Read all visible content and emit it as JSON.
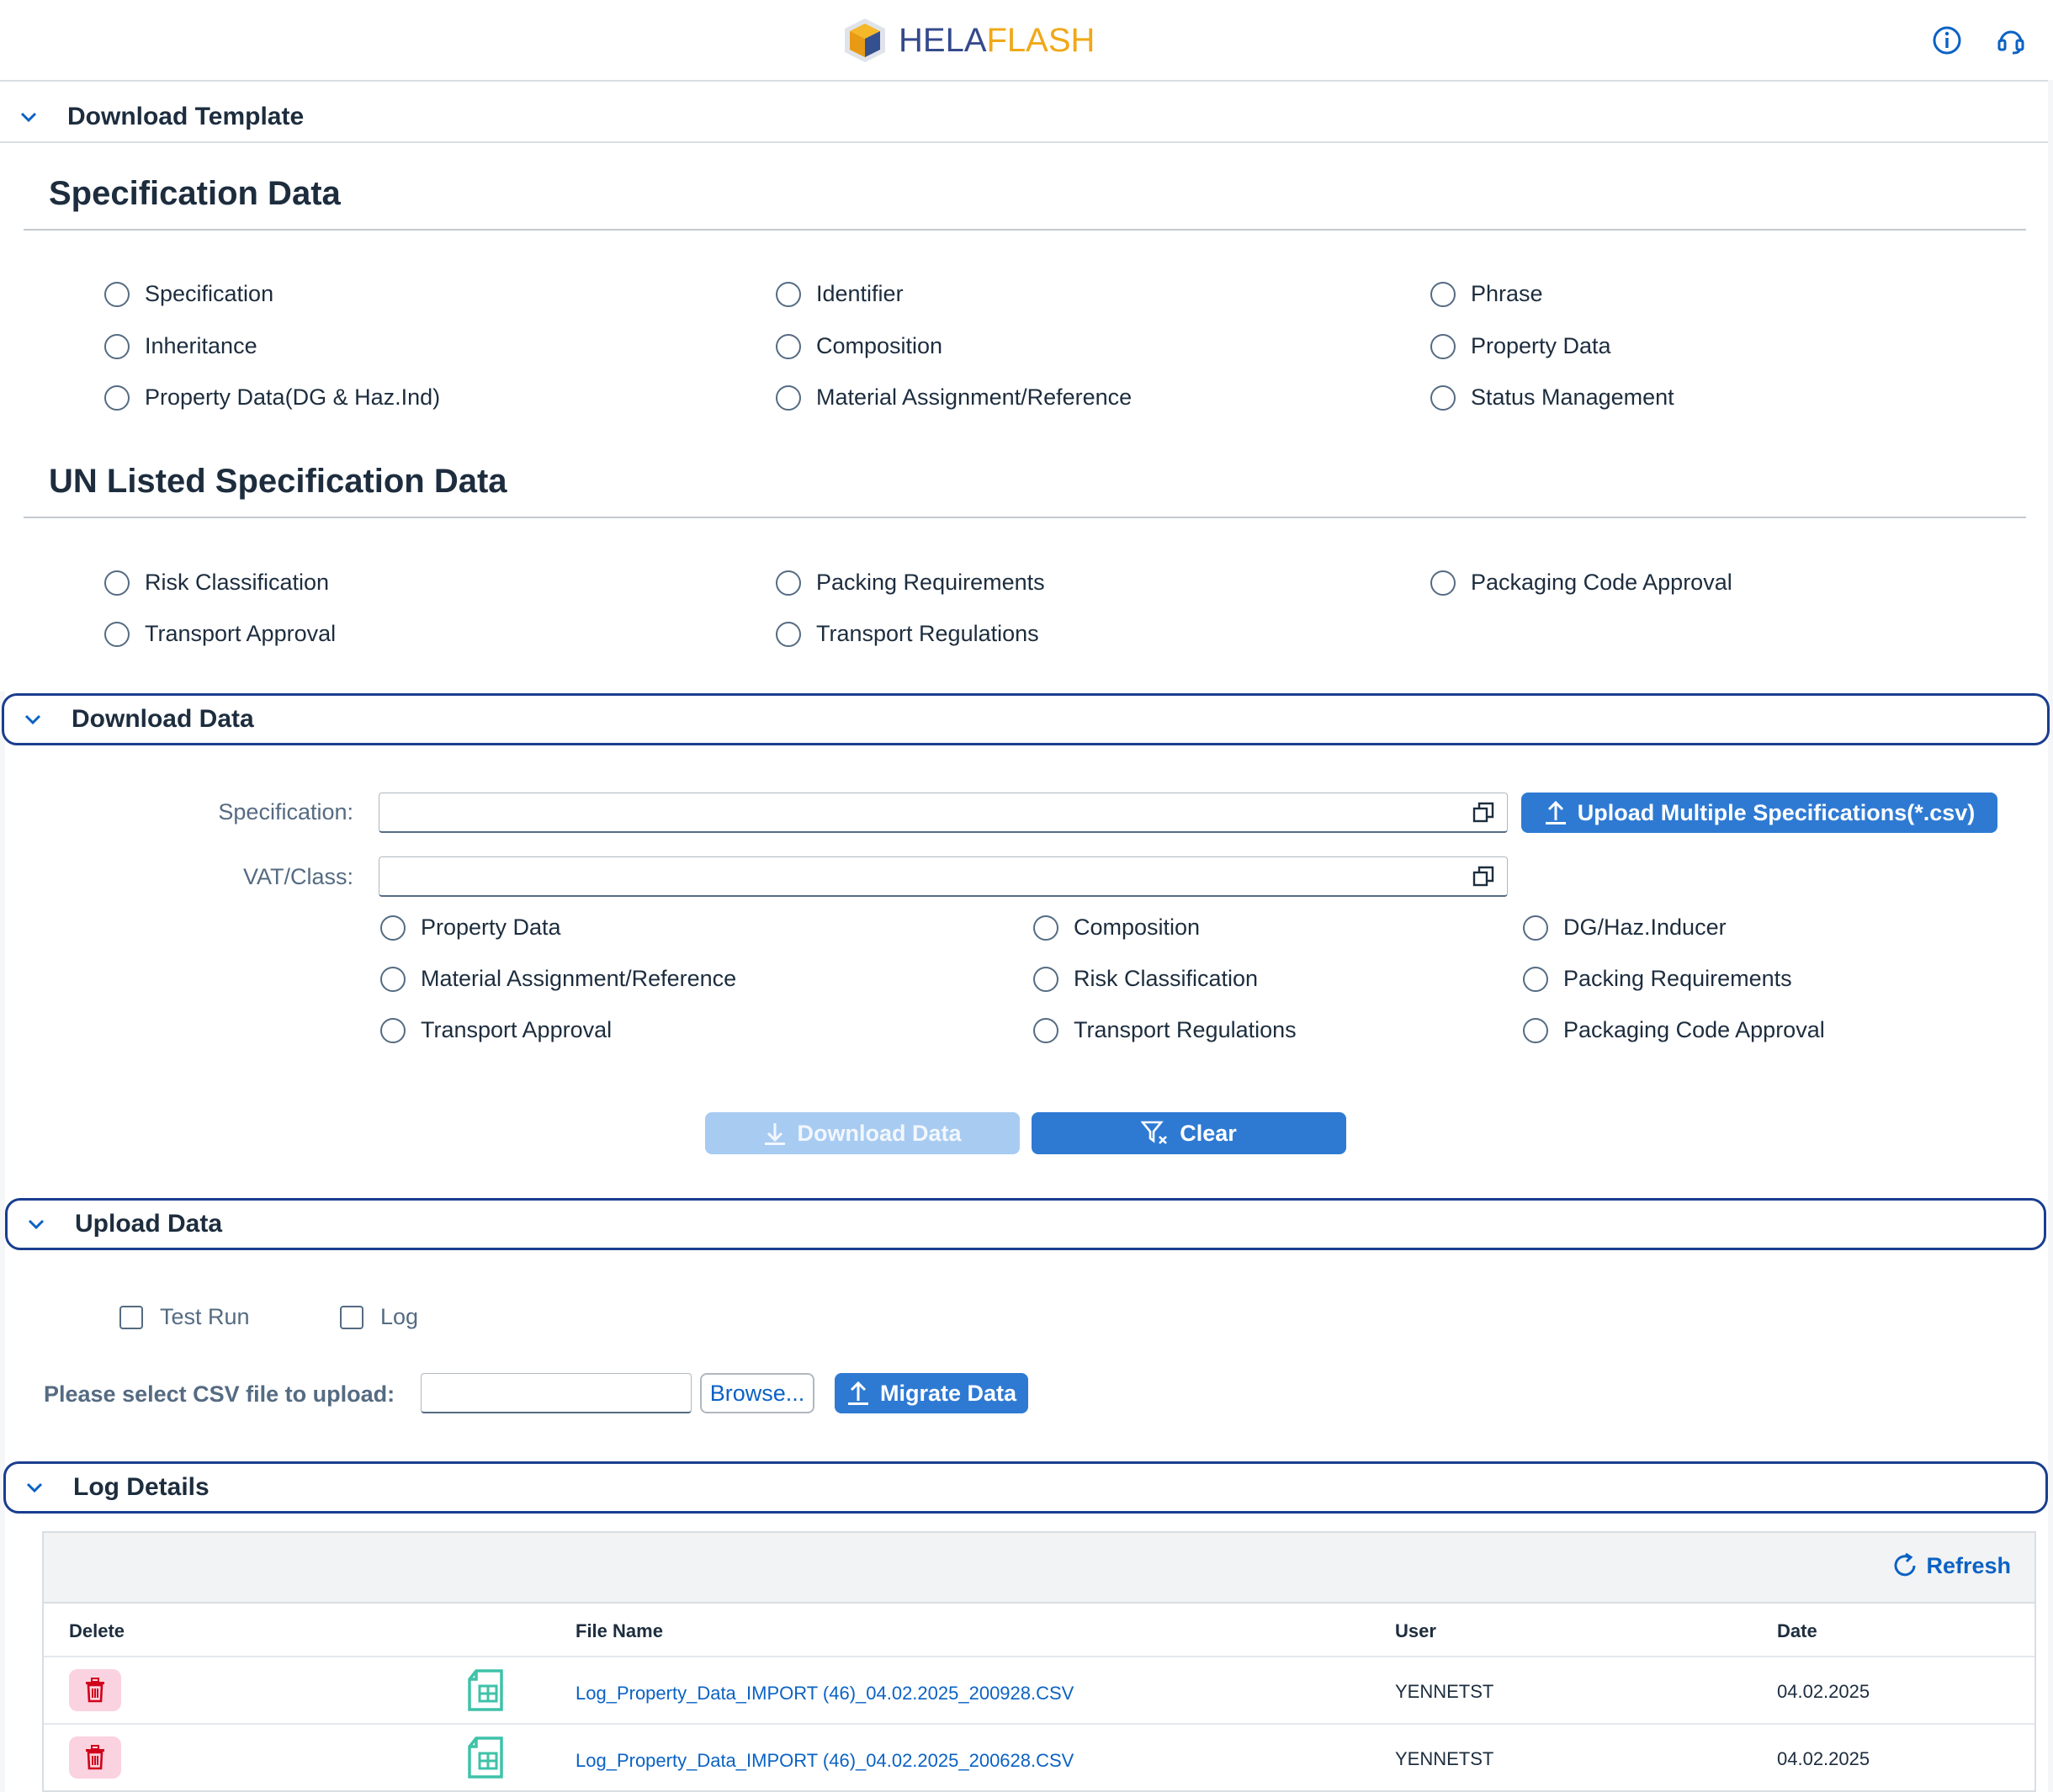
{
  "header": {
    "logo_part1": "HELA",
    "logo_part2": "FLASH",
    "info_icon": "info-icon",
    "support_icon": "headset-icon"
  },
  "download_template": {
    "title": "Download Template",
    "spec_heading": "Specification Data",
    "spec_options": [
      "Specification",
      "Identifier",
      "Phrase",
      "Inheritance",
      "Composition",
      "Property Data",
      "Property Data(DG & Haz.Ind)",
      "Material Assignment/Reference",
      "Status Management"
    ],
    "un_heading": "UN Listed Specification Data",
    "un_options": [
      "Risk Classification",
      "Packing Requirements",
      "Packaging Code Approval",
      "Transport Approval",
      "Transport Regulations"
    ]
  },
  "download_data": {
    "title": "Download Data",
    "spec_label": "Specification:",
    "spec_value": "",
    "vat_label": "VAT/Class:",
    "vat_value": "",
    "upload_multi": "Upload Multiple Specifications(*.csv)",
    "options": [
      "Property Data",
      "Composition",
      "DG/Haz.Inducer",
      "Material Assignment/Reference",
      "Risk Classification",
      "Packing Requirements",
      "Transport Approval",
      "Transport Regulations",
      "Packaging Code Approval"
    ],
    "download_btn": "Download Data",
    "clear_btn": "Clear"
  },
  "upload_data": {
    "title": "Upload Data",
    "test_run": "Test Run",
    "log": "Log",
    "csv_label": "Please select CSV file to upload:",
    "browse": "Browse...",
    "migrate": "Migrate Data"
  },
  "log_details": {
    "title": "Log Details",
    "refresh": "Refresh",
    "columns": {
      "delete": "Delete",
      "file_name": "File Name",
      "user": "User",
      "date": "Date"
    },
    "rows": [
      {
        "file": "Log_Property_Data_IMPORT (46)_04.02.2025_200928.CSV",
        "user": "YENNETST",
        "date": "04.02.2025"
      },
      {
        "file": "Log_Property_Data_IMPORT (46)_04.02.2025_200628.CSV",
        "user": "YENNETST",
        "date": "04.02.2025"
      }
    ]
  },
  "colors": {
    "accent": "#2e7ad3",
    "focus_border": "#1a3d8f",
    "link": "#0b62c4",
    "delete_bg": "#fbd2df",
    "delete_icon": "#d0021b"
  }
}
